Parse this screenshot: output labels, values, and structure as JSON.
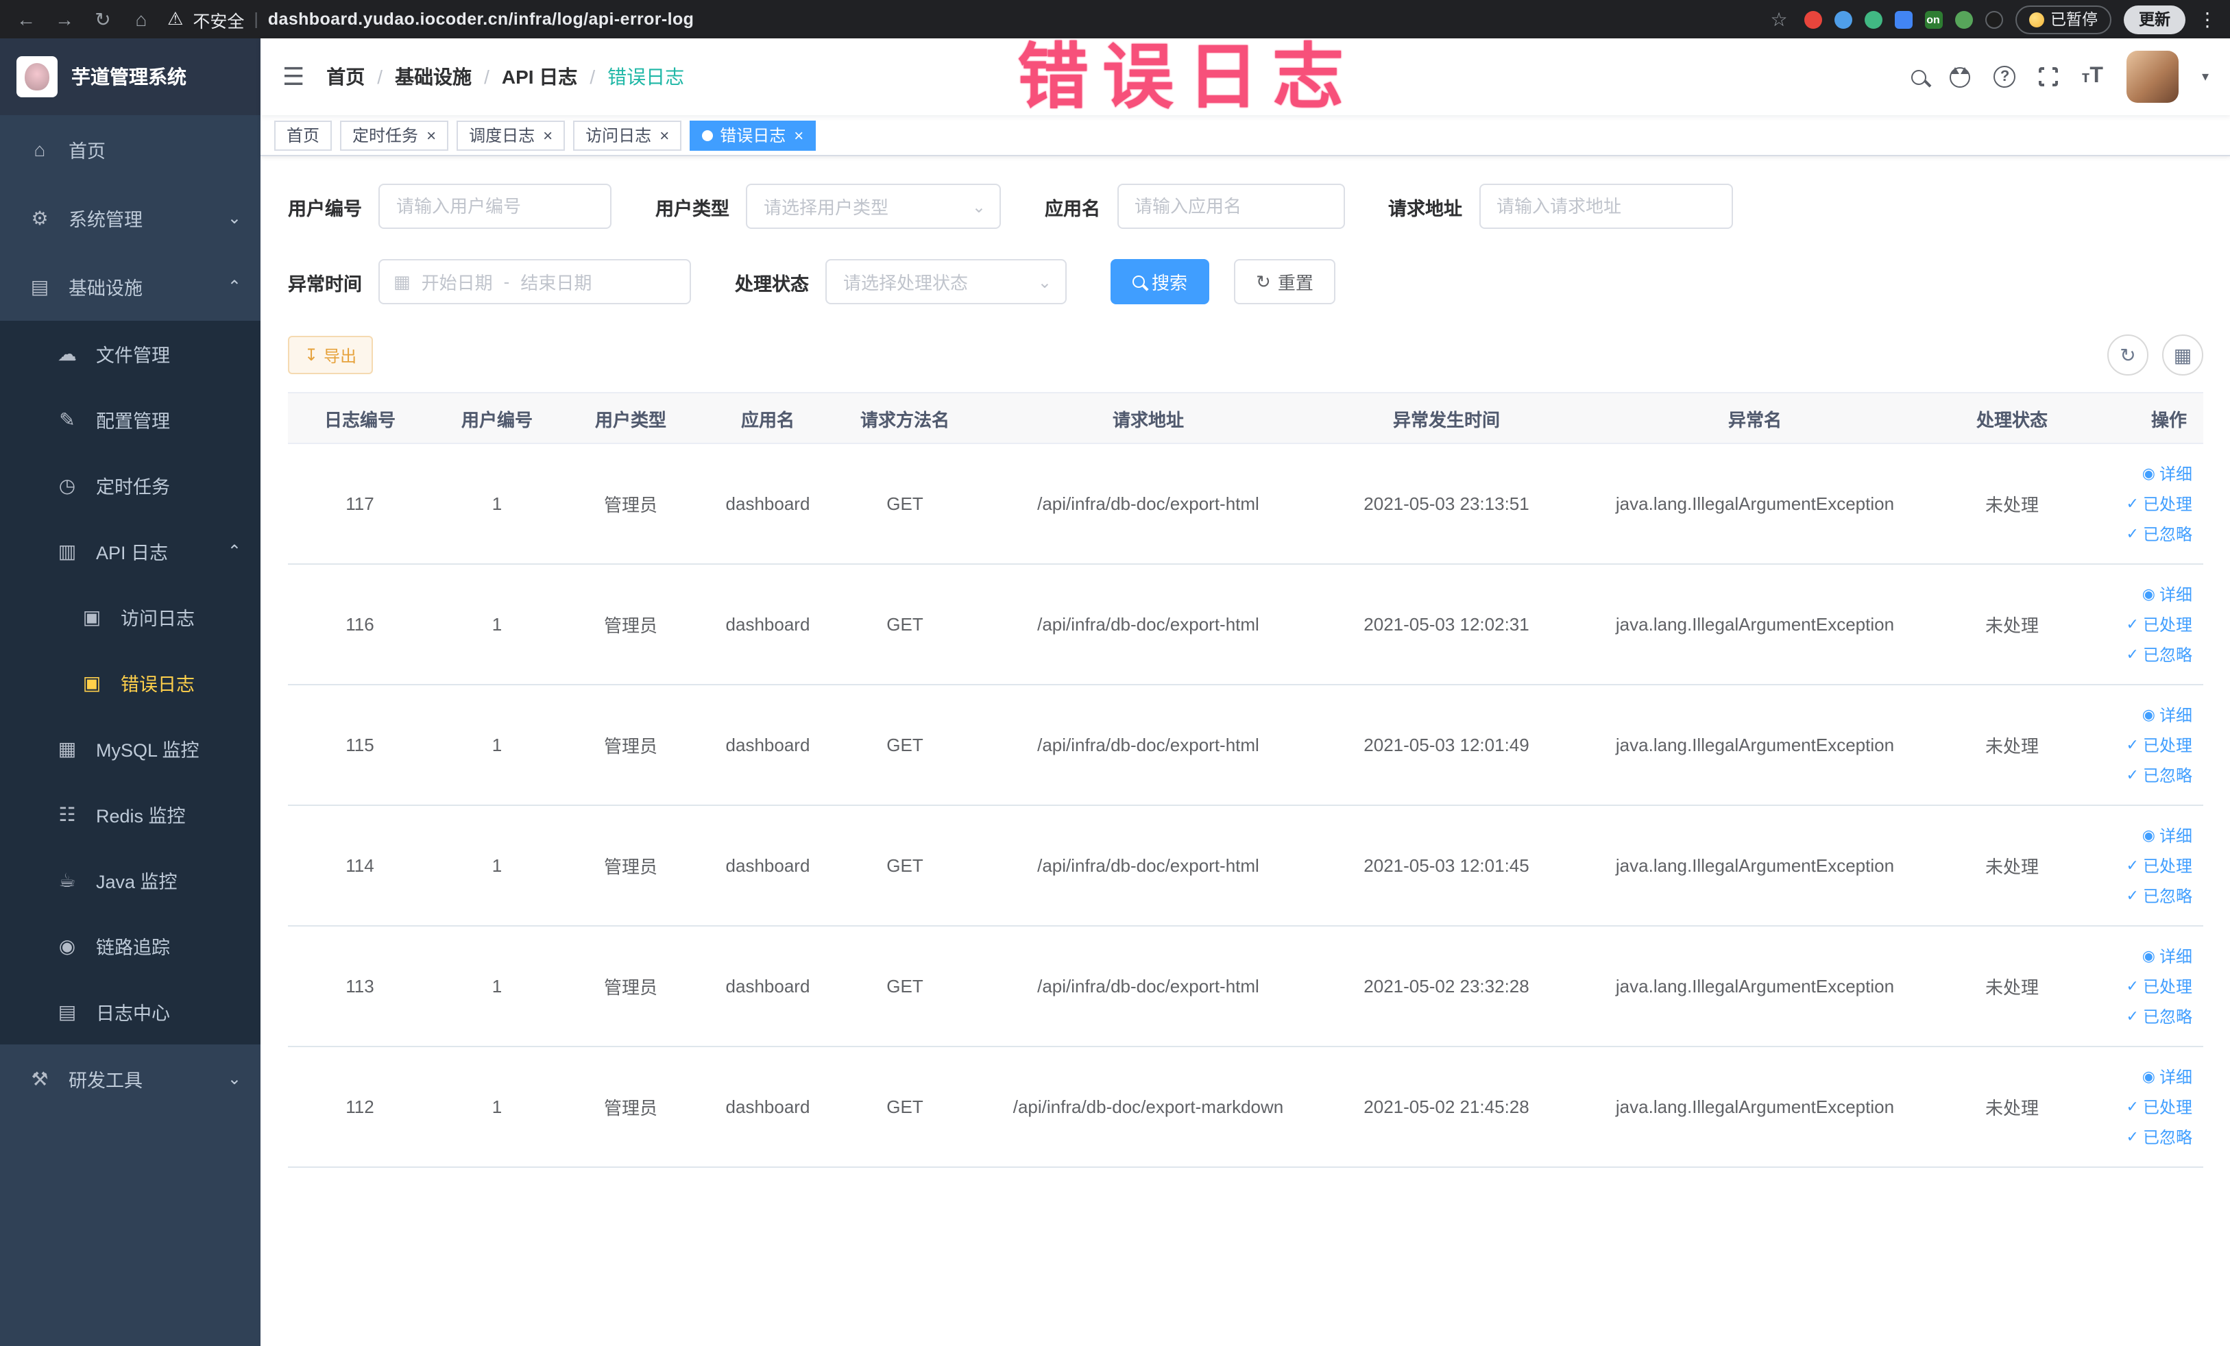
{
  "browser": {
    "security_warning": "不安全",
    "url": "dashboard.yudao.iocoder.cn/infra/log/api-error-log",
    "on_badge": "on",
    "paused_badge": "已暂停",
    "update_button": "更新"
  },
  "annotation": {
    "title": "错误日志"
  },
  "sidebar": {
    "logo_title": "芋道管理系统",
    "items": {
      "home": "首页",
      "system": "系统管理",
      "infra": "基础设施",
      "file": "文件管理",
      "config": "配置管理",
      "job": "定时任务",
      "api_log": "API 日志",
      "access_log": "访问日志",
      "error_log": "错误日志",
      "mysql": "MySQL 监控",
      "redis": "Redis 监控",
      "java": "Java 监控",
      "trace": "链路追踪",
      "log_center": "日志中心",
      "dev_tools": "研发工具"
    }
  },
  "header": {
    "breadcrumb": [
      "首页",
      "基础设施",
      "API 日志",
      "错误日志"
    ],
    "breadcrumb_separator": "/"
  },
  "tabs": [
    {
      "label": "首页",
      "closable": false,
      "active": false
    },
    {
      "label": "定时任务",
      "closable": true,
      "active": false
    },
    {
      "label": "调度日志",
      "closable": true,
      "active": false
    },
    {
      "label": "访问日志",
      "closable": true,
      "active": false
    },
    {
      "label": "错误日志",
      "closable": true,
      "active": true
    }
  ],
  "filters": {
    "user_id": {
      "label": "用户编号",
      "placeholder": "请输入用户编号"
    },
    "user_type": {
      "label": "用户类型",
      "placeholder": "请选择用户类型"
    },
    "app_name": {
      "label": "应用名",
      "placeholder": "请输入应用名"
    },
    "request_url": {
      "label": "请求地址",
      "placeholder": "请输入请求地址"
    },
    "exception_time": {
      "label": "异常时间",
      "start_placeholder": "开始日期",
      "separator": "-",
      "end_placeholder": "结束日期"
    },
    "process_status": {
      "label": "处理状态",
      "placeholder": "请选择处理状态"
    },
    "search_button": "搜索",
    "reset_button": "重置"
  },
  "toolbar": {
    "export_button": "导出"
  },
  "table": {
    "columns": [
      "日志编号",
      "用户编号",
      "用户类型",
      "应用名",
      "请求方法名",
      "请求地址",
      "异常发生时间",
      "异常名",
      "处理状态",
      "操作"
    ],
    "action_labels": {
      "detail": "详细",
      "processed": "已处理",
      "ignored": "已忽略"
    },
    "rows": [
      {
        "id": "117",
        "user_id": "1",
        "user_type": "管理员",
        "app": "dashboard",
        "method": "GET",
        "url": "/api/infra/db-doc/export-html",
        "time": "2021-05-03 23:13:51",
        "exception": "java.lang.IllegalArgumentException",
        "status": "未处理"
      },
      {
        "id": "116",
        "user_id": "1",
        "user_type": "管理员",
        "app": "dashboard",
        "method": "GET",
        "url": "/api/infra/db-doc/export-html",
        "time": "2021-05-03 12:02:31",
        "exception": "java.lang.IllegalArgumentException",
        "status": "未处理"
      },
      {
        "id": "115",
        "user_id": "1",
        "user_type": "管理员",
        "app": "dashboard",
        "method": "GET",
        "url": "/api/infra/db-doc/export-html",
        "time": "2021-05-03 12:01:49",
        "exception": "java.lang.IllegalArgumentException",
        "status": "未处理"
      },
      {
        "id": "114",
        "user_id": "1",
        "user_type": "管理员",
        "app": "dashboard",
        "method": "GET",
        "url": "/api/infra/db-doc/export-html",
        "time": "2021-05-03 12:01:45",
        "exception": "java.lang.IllegalArgumentException",
        "status": "未处理"
      },
      {
        "id": "113",
        "user_id": "1",
        "user_type": "管理员",
        "app": "dashboard",
        "method": "GET",
        "url": "/api/infra/db-doc/export-html",
        "time": "2021-05-02 23:32:28",
        "exception": "java.lang.IllegalArgumentException",
        "status": "未处理"
      },
      {
        "id": "112",
        "user_id": "1",
        "user_type": "管理员",
        "app": "dashboard",
        "method": "GET",
        "url": "/api/infra/db-doc/export-markdown",
        "time": "2021-05-02 21:45:28",
        "exception": "java.lang.IllegalArgumentException",
        "status": "未处理"
      }
    ]
  },
  "icons": {
    "back": "←",
    "forward": "→",
    "reload": "↻",
    "home": "⌂",
    "warning": "⚠",
    "star": "☆",
    "menu_dots": "⋮",
    "hamburger": "☰",
    "caret_down": "▾",
    "chevron_down": "⌄",
    "chevron_up": "⌃",
    "check": "✓",
    "eye": "◉",
    "download": "↧",
    "refresh": "↻",
    "grid": "▦",
    "calendar": "▦",
    "separator": "|",
    "close": "×",
    "menu_home": "⌂",
    "menu_gear": "⚙",
    "menu_infra": "▤",
    "menu_file": "☁",
    "menu_config": "✎",
    "menu_cron": "◷",
    "menu_api": "▥",
    "menu_doc": "▣",
    "menu_mysql": "▦",
    "menu_redis": "☷",
    "menu_java": "☕",
    "menu_trace": "◉",
    "menu_log": "▤",
    "menu_tools": "⚒"
  },
  "colors": {
    "primary": "#409eff",
    "sidebar_bg": "#304156",
    "submenu_bg": "#1f2d3d",
    "active_menu_text": "#ffd04b",
    "warning": "#e6a23c",
    "annotation_pink": "#f7507a",
    "breadcrumb_highlight": "#1fb7a6",
    "link": "#409eff"
  }
}
